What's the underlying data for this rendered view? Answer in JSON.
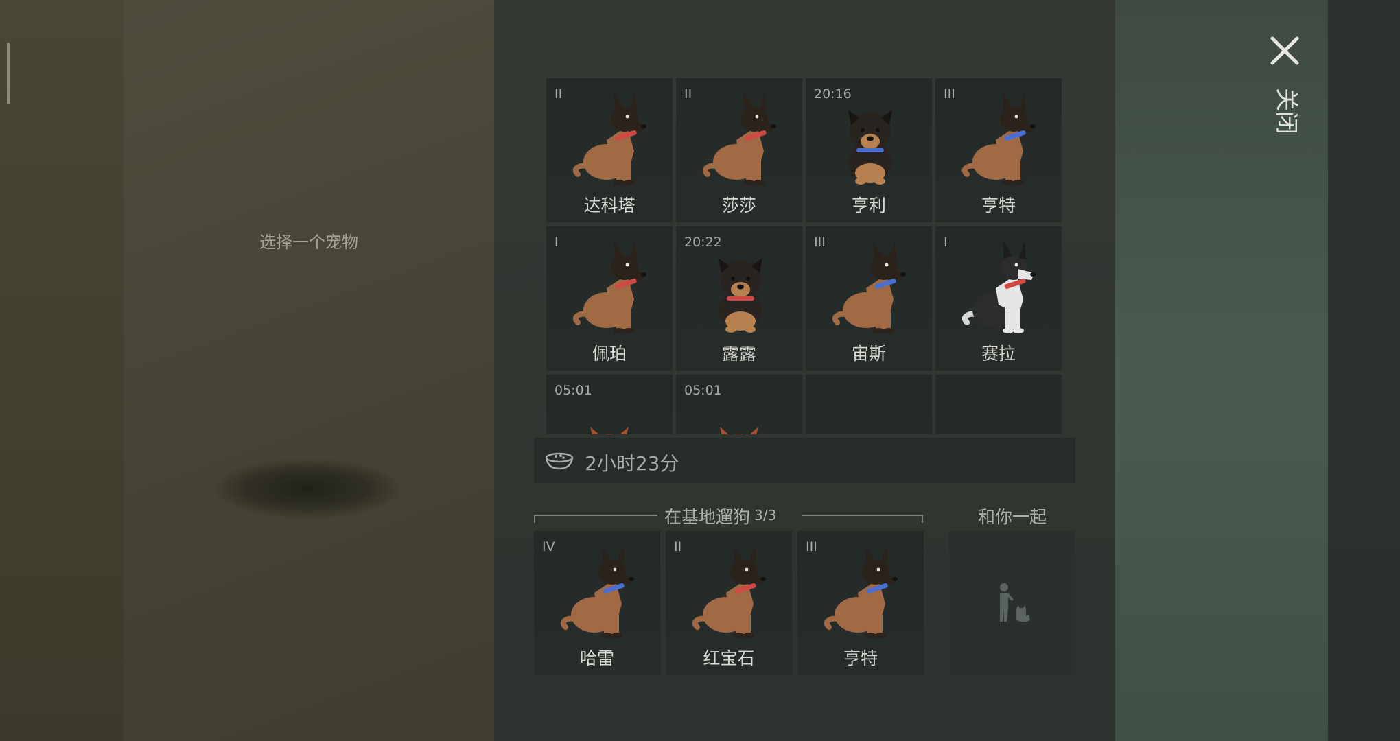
{
  "left_panel": {
    "prompt": "选择一个宠物"
  },
  "close": {
    "label": "关闭"
  },
  "kennel": [
    {
      "badge": "II",
      "name": "达科塔",
      "kind": "shepherd",
      "collar": "#d04a45"
    },
    {
      "badge": "II",
      "name": "莎莎",
      "kind": "shepherd",
      "collar": "#d04a45"
    },
    {
      "badge": "20:16",
      "name": "亨利",
      "kind": "puppy",
      "collar": "#4a6fd0"
    },
    {
      "badge": "III",
      "name": "亨特",
      "kind": "shepherd",
      "collar": "#4a6fd0"
    },
    {
      "badge": "I",
      "name": "佩珀",
      "kind": "shepherd",
      "collar": "#d04a45"
    },
    {
      "badge": "20:22",
      "name": "露露",
      "kind": "puppy",
      "collar": "#d04a45"
    },
    {
      "badge": "III",
      "name": "宙斯",
      "kind": "shepherd",
      "collar": "#4a6fd0"
    },
    {
      "badge": "I",
      "name": "赛拉",
      "kind": "husky",
      "collar": "#d04a45"
    },
    {
      "badge": "05:01",
      "name": "",
      "kind": "husky-pup",
      "collar": "#d04a45"
    },
    {
      "badge": "05:01",
      "name": "",
      "kind": "husky-pup",
      "collar": "#d04a45"
    },
    {
      "badge": "",
      "name": "",
      "kind": "empty"
    },
    {
      "badge": "",
      "name": "",
      "kind": "empty"
    }
  ],
  "food": {
    "time_left": "2小时23分",
    "icon": "food-bowl-icon"
  },
  "walking": {
    "title": "在基地遛狗",
    "count": "3/3",
    "dogs": [
      {
        "badge": "IV",
        "name": "哈雷",
        "kind": "shepherd",
        "collar": "#4a6fd0"
      },
      {
        "badge": "II",
        "name": "红宝石",
        "kind": "shepherd",
        "collar": "#d04a45"
      },
      {
        "badge": "III",
        "name": "亨特",
        "kind": "shepherd",
        "collar": "#4a6fd0"
      }
    ]
  },
  "with_you": {
    "title": "和你一起",
    "icon": "person-with-dog-icon"
  }
}
